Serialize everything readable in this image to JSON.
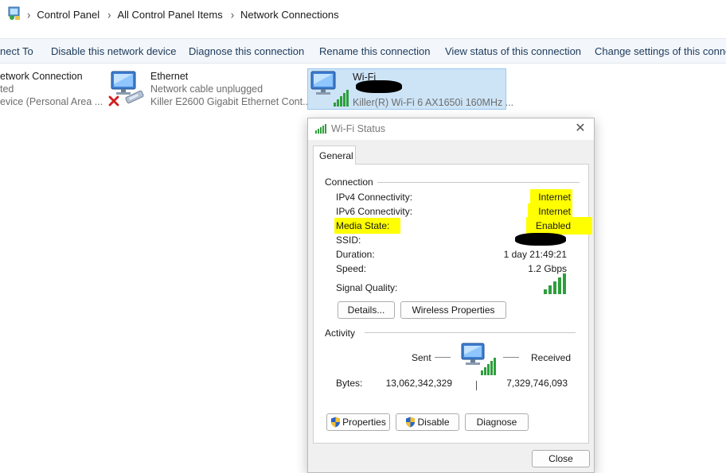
{
  "breadcrumb": {
    "items": [
      "Control Panel",
      "All Control Panel Items",
      "Network Connections"
    ]
  },
  "commands": [
    "nect To",
    "Disable this network device",
    "Diagnose this connection",
    "Rename this connection",
    "View status of this connection",
    "Change settings of this connect"
  ],
  "adapters": [
    {
      "name": "etwork Connection",
      "status": "ted",
      "device": "evice (Personal Area ..."
    },
    {
      "name": "Ethernet",
      "status": "Network cable unplugged",
      "device": "Killer E2600 Gigabit Ethernet Cont..."
    },
    {
      "name": "Wi-Fi",
      "status": "",
      "device": "Killer(R) Wi-Fi 6 AX1650i 160MHz ..."
    }
  ],
  "dialog": {
    "title": "Wi-Fi Status",
    "close_glyph": "✕",
    "tab": "General",
    "connection": {
      "heading": "Connection",
      "rows": [
        {
          "label": "IPv4 Connectivity:",
          "value": "Internet"
        },
        {
          "label": "IPv6 Connectivity:",
          "value": "Internet"
        },
        {
          "label": "Media State:",
          "value": "Enabled"
        },
        {
          "label": "SSID:",
          "value": ""
        },
        {
          "label": "Duration:",
          "value": "1 day 21:49:21"
        },
        {
          "label": "Speed:",
          "value": "1.2 Gbps"
        }
      ],
      "signal_label": "Signal Quality:",
      "signal_bars": 5,
      "details_button": "Details...",
      "wireless_button": "Wireless Properties"
    },
    "activity": {
      "heading": "Activity",
      "sent_label": "Sent",
      "received_label": "Received",
      "bytes_label": "Bytes:",
      "bytes_sent": "13,062,342,329",
      "bytes_received": "7,329,746,093"
    },
    "buttons": {
      "properties": "Properties",
      "disable": "Disable",
      "diagnose": "Diagnose",
      "close": "Close"
    }
  },
  "colors": {
    "highlight": "#ffff00",
    "selection": "#cde4f7",
    "command_text": "#1b3a5c",
    "signal_green": "#2e9e3c"
  },
  "icons": [
    "control-panel-icon",
    "chevron-right-icon",
    "network-adapter-icon",
    "red-x-icon",
    "cable-icon",
    "wifi-signal-icon",
    "shield-icon",
    "close-icon"
  ]
}
